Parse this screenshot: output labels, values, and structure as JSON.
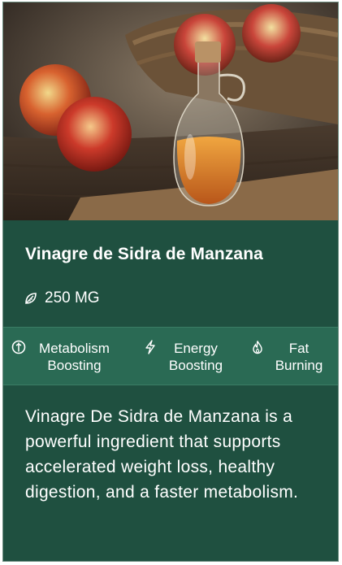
{
  "card": {
    "image_alt": "Apple cider vinegar bottle with apples",
    "title": "Vinagre de Sidra de Manzana",
    "dose": {
      "icon": "leaf-icon",
      "text": "250 MG"
    },
    "benefits": [
      {
        "icon": "metabolism-icon",
        "label": "Metabolism\nBoosting"
      },
      {
        "icon": "lightning-icon",
        "label": "Energy\nBoosting"
      },
      {
        "icon": "flame-icon",
        "label": "Fat\nBurning"
      }
    ],
    "description": "Vinagre De Sidra de Manzana is a powerful ingredient that supports accelerated weight loss, healthy digestion, and a faster metabolism."
  },
  "colors": {
    "card_bg": "#1f5040",
    "benefits_bg": "#2a6a54",
    "text": "#ffffff"
  }
}
